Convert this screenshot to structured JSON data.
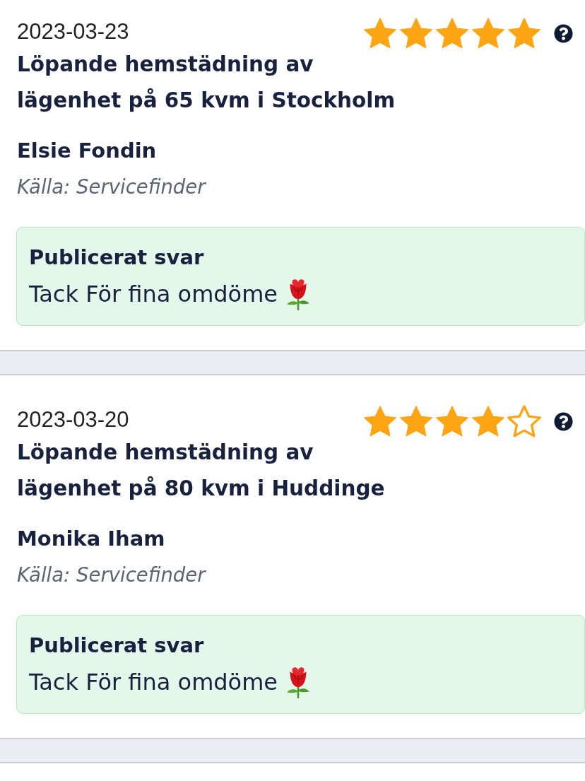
{
  "reviews": [
    {
      "date": "2023-03-23",
      "stars": 5,
      "title": "Löpande hemstädning av lägenhet på 65 kvm i Stockholm",
      "author": "Elsie Fondin",
      "source": "Källa: Servicefinder",
      "reply": {
        "heading": "Publicerat svar",
        "text": "Tack För fina omdöme"
      }
    },
    {
      "date": "2023-03-20",
      "stars": 4,
      "title": "Löpande hemstädning av lägenhet på 80 kvm i Huddinge",
      "author": "Monika Iham",
      "source": "Källa: Servicefinder",
      "reply": {
        "heading": "Publicerat svar",
        "text": "Tack För fina omdöme"
      }
    }
  ]
}
